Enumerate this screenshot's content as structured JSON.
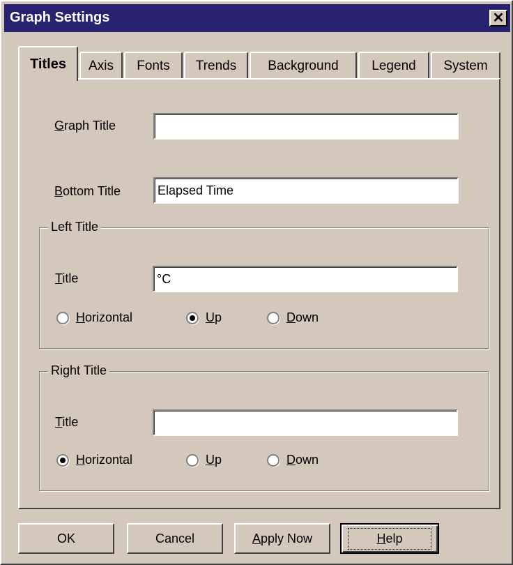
{
  "window": {
    "title": "Graph Settings"
  },
  "tabs": [
    {
      "label": "Titles",
      "active": true
    },
    {
      "label": "Axis",
      "active": false
    },
    {
      "label": "Fonts",
      "active": false
    },
    {
      "label": "Trends",
      "active": false
    },
    {
      "label": "Background",
      "active": false
    },
    {
      "label": "Legend",
      "active": false
    },
    {
      "label": "System",
      "active": false
    }
  ],
  "titles_tab": {
    "graph_title": {
      "label_mnemonic": "G",
      "label_rest": "raph Title",
      "value": ""
    },
    "bottom_title": {
      "label_mnemonic": "B",
      "label_rest": "ottom Title",
      "value": "Elapsed Time"
    },
    "left_title": {
      "group_label": "Left Title",
      "title_mnemonic": "T",
      "title_rest": "itle",
      "value": "°C",
      "orientation": "Up",
      "options": [
        {
          "mnemonic": "H",
          "rest": "orizontal"
        },
        {
          "mnemonic": "U",
          "rest": "p"
        },
        {
          "mnemonic": "D",
          "rest": "own"
        }
      ]
    },
    "right_title": {
      "group_label": "Right Title",
      "title_mnemonic": "T",
      "title_rest": "itle",
      "value": "",
      "orientation": "Horizontal",
      "options": [
        {
          "mnemonic": "H",
          "rest": "orizontal"
        },
        {
          "mnemonic": "U",
          "rest": "p"
        },
        {
          "mnemonic": "D",
          "rest": "own"
        }
      ]
    }
  },
  "buttons": {
    "ok": "OK",
    "cancel": "Cancel",
    "apply_mnemonic": "A",
    "apply_rest": "pply Now",
    "help_mnemonic": "H",
    "help_rest": "elp"
  },
  "colors": {
    "titlebar": "#282270",
    "face": "#d4c8bc"
  },
  "icons": {
    "close": "close-icon"
  }
}
